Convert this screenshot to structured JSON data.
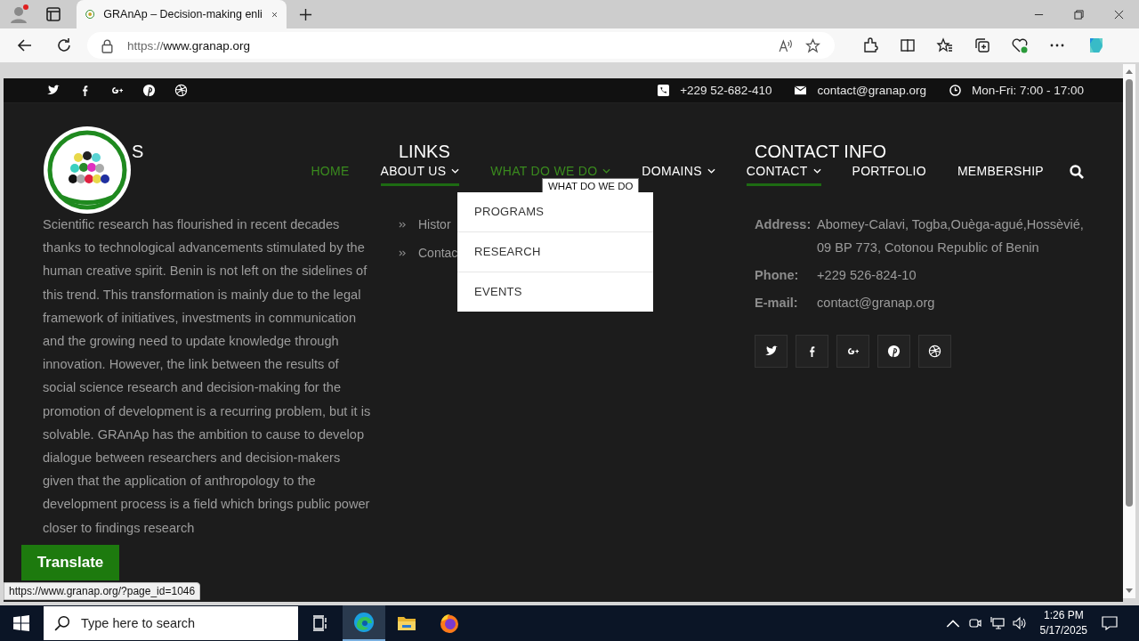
{
  "browser": {
    "tabs": [
      {
        "title": "GRAnAp – Decision-making enli",
        "selected": true
      }
    ],
    "url_scheme": "https://",
    "url_host": "www.granap.org"
  },
  "topbar": {
    "phone": "+229 52-682-410",
    "email": "contact@granap.org",
    "hours": "Mon-Fri: 7:00 - 17:00"
  },
  "nav": {
    "items": [
      {
        "label": "HOME",
        "selected": true,
        "underline": false,
        "dropdown": false
      },
      {
        "label": "ABOUT US",
        "selected": false,
        "underline": true,
        "dropdown": true
      },
      {
        "label": "WHAT DO WE DO",
        "selected": true,
        "underline": false,
        "dropdown": true
      },
      {
        "label": "DOMAINS",
        "selected": false,
        "underline": false,
        "dropdown": true
      },
      {
        "label": "CONTACT",
        "selected": false,
        "underline": true,
        "dropdown": true
      },
      {
        "label": "PORTFOLIO",
        "selected": false,
        "underline": false,
        "dropdown": false
      },
      {
        "label": "MEMBERSHIP",
        "selected": false,
        "underline": false,
        "dropdown": false
      }
    ]
  },
  "submenu": {
    "tooltip": "WHAT DO WE DO",
    "items": [
      "PROGRAMS",
      "RESEARCH",
      "EVENTS"
    ]
  },
  "footer": {
    "about": {
      "heading": "S",
      "text": "Scientific research has flourished in recent decades thanks to technological advancements stimulated by the human creative spirit. Benin is not left on the sidelines of this trend. This transformation is mainly due to the legal framework of initiatives, investments in communication and the growing need to update knowledge through innovation. However, the link between the results of social science research and decision-making for the promotion of development is a recurring problem, but it is solvable. GRAnAp has the ambition to cause to develop dialogue between researchers and decision-makers given that the application of anthropology to the development process is a field which brings public power closer to findings research"
    },
    "links": {
      "heading": "LINKS",
      "items": [
        "Histor",
        "Contac"
      ]
    },
    "contact": {
      "heading": "CONTACT INFO",
      "rows": [
        {
          "label": "Address:",
          "value": "Abomey-Calavi, Togba,Ouèga-agué,Hossèvié, 09 BP 773, Cotonou Republic of Benin"
        },
        {
          "label": "Phone:",
          "value": "+229 526-824-10"
        },
        {
          "label": "E-mail:",
          "value": "contact@granap.org"
        }
      ]
    }
  },
  "translate_button": "Translate",
  "status_url": "https://www.granap.org/?page_id=1046",
  "taskbar": {
    "search_placeholder": "Type here to search",
    "time": "1:26 PM",
    "date": "5/17/2025"
  }
}
